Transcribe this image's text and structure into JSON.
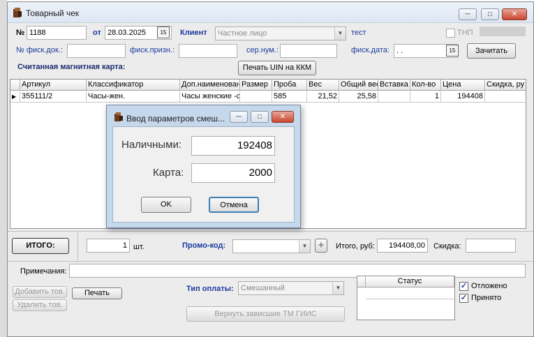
{
  "window": {
    "title": "Товарный чек"
  },
  "header": {
    "number_label": "№",
    "number_value": "1188",
    "date_label": "от",
    "date_value": "28.03.2025",
    "client_label": "Клиент",
    "client_value": "Частное лицо",
    "test_label": "тест",
    "tnp_label": "ТНП",
    "fisc_doc_label": "№ фиск.док.:",
    "fisc_doc_value": "",
    "fisc_sign_label": "фиск.призн.:",
    "fisc_sign_value": "",
    "ser_num_label": "сер.нум.:",
    "ser_num_value": "",
    "fisc_date_label": "фиск.дата:",
    "fisc_date_value": ". .",
    "read_button": "Зачитать",
    "magcard_label": "Считанная магнитная карта:",
    "print_uin_button": "Печать UIN на ККМ"
  },
  "grid": {
    "columns": [
      "Артикул",
      "Классификатор",
      "Доп.наименован",
      "Размер",
      "Проба",
      "Вес",
      "Общий вес",
      "Вставка",
      "Кол-во",
      "Цена",
      "Скидка, ру"
    ],
    "rows": [
      [
        "355111/2",
        "Часы-жен.",
        "Часы женские -с",
        "",
        "585",
        "21,52",
        "25,58",
        "",
        "1",
        "194408",
        ""
      ]
    ]
  },
  "summary": {
    "total_button": "ИТОГО:",
    "qty_value": "1",
    "qty_unit": "шт.",
    "promo_label": "Промо-код:",
    "promo_value": "",
    "total_rub_label": "Итого, руб:",
    "total_rub_value": "194408,00",
    "discount_label": "Скидка:",
    "discount_value": ""
  },
  "notes": {
    "label": "Примечания:",
    "value": ""
  },
  "footer": {
    "add_item_button": "Добавить тов.",
    "delete_item_button": "Удалить тов.",
    "print_button": "Печать",
    "payment_type_label": "Тип оплаты:",
    "payment_type_value": "Смешанный",
    "return_button": "Вернуть зависшие ТМ ГИИС",
    "status_header": "Статус",
    "postponed_label": "Отложено",
    "postponed_checked": true,
    "accepted_label": "Принято",
    "accepted_checked": true
  },
  "dialog": {
    "title": "Ввод параметров смеш...",
    "cash_label": "Наличными:",
    "cash_value": "192408",
    "card_label": "Карта:",
    "card_value": "2000",
    "ok_button": "OK",
    "cancel_button": "Отмена"
  },
  "colors": {
    "accent_blue": "#1b3a9e",
    "dialog_frame": "#c6d8ec",
    "close_red": "#c9462f"
  }
}
